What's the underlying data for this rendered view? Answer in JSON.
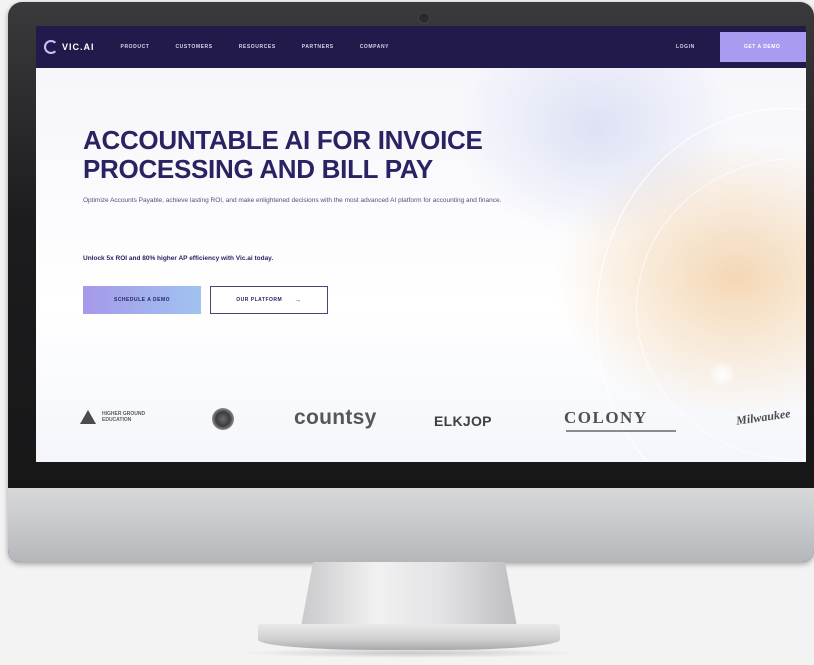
{
  "nav": {
    "logo_text": "VIC.AI",
    "links": [
      "PRODUCT",
      "CUSTOMERS",
      "RESOURCES",
      "PARTNERS",
      "COMPANY"
    ],
    "login": "LOGIN",
    "cta": "GET A DEMO"
  },
  "hero": {
    "headline": "ACCOUNTABLE AI FOR INVOICE PROCESSING AND BILL PAY",
    "subtext": "Optimize Accounts Payable, achieve lasting ROI, and make enlightened decisions with the most advanced AI platform for accounting and finance.",
    "unlock": "Unlock 5x ROI and 80% higher AP efficiency with Vic.ai today.",
    "primary_button": "SCHEDULE A DEMO",
    "secondary_button": "OUR PLATFORM",
    "secondary_arrow": "→"
  },
  "customer_logos": {
    "logo1": "HIGHER GROUND EDUCATION",
    "countsy": "countsy",
    "elkjop": "ELKJOP",
    "colony": "COLONY",
    "milwaukee": "Milwaukee"
  },
  "colors": {
    "nav_bg": "#211a4a",
    "headline": "#2a2363",
    "cta": "#a99cf0"
  }
}
